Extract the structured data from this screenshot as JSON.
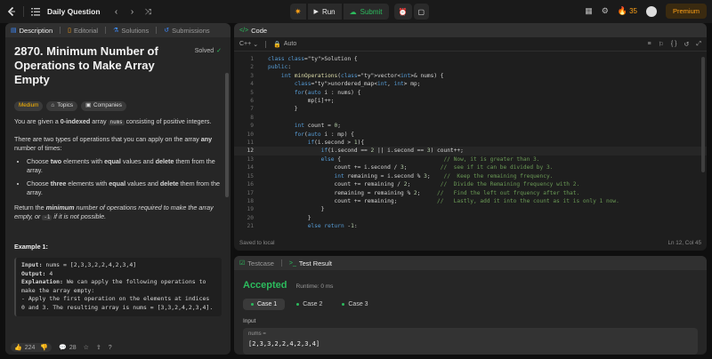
{
  "topbar": {
    "title": "Daily Question",
    "run_label": "Run",
    "submit_label": "Submit",
    "streak_count": "35",
    "premium_label": "Premium"
  },
  "left_tabs": {
    "description": "Description",
    "editorial": "Editorial",
    "solutions": "Solutions",
    "submissions": "Submissions"
  },
  "problem": {
    "title": "2870. Minimum Number of Operations to Make Array Empty",
    "solved_label": "Solved",
    "difficulty": "Medium",
    "topics_label": "Topics",
    "companies_label": "Companies",
    "p1_a": "You are given a ",
    "p1_b": "0-indexed",
    "p1_c": " array ",
    "p1_code": "nums",
    "p1_d": " consisting of positive integers.",
    "p2_a": "There are two types of operations that you can apply on the array ",
    "p2_b": "any",
    "p2_c": " number of times:",
    "b1_a": "Choose ",
    "b1_b": "two",
    "b1_c": " elements with ",
    "b1_d": "equal",
    "b1_e": " values and ",
    "b1_f": "delete",
    "b1_g": " them from the array.",
    "b2_a": "Choose ",
    "b2_b": "three",
    "b2_c": " elements with ",
    "b2_d": "equal",
    "b2_e": " values and ",
    "b2_f": "delete",
    "b2_g": " them from the array.",
    "p3_a": "Return the ",
    "p3_b": "minimum",
    "p3_c": " number of operations required to make the array empty, or ",
    "p3_code": "-1",
    "p3_d": " if it is not possible.",
    "example_title": "Example 1:",
    "ex_input_label": "Input:",
    "ex_input": " nums = [2,3,3,2,2,4,2,3,4]",
    "ex_output_label": "Output:",
    "ex_output": " 4",
    "ex_expl_label": "Explanation:",
    "ex_expl_1": " We can apply the following operations to make the array empty:",
    "ex_expl_2": "- Apply the first operation on the elements at indices 0 and 3. The resulting array is nums = [3,3,2,4,2,3,4]."
  },
  "left_footer": {
    "likes": "224",
    "comments": "28"
  },
  "code_panel": {
    "title": "Code",
    "language": "C++",
    "auto_label": "Auto",
    "status": "Saved to local",
    "cursor": "Ln 12, Col 45",
    "lines": [
      {
        "n": "1",
        "t": "class Solution {"
      },
      {
        "n": "2",
        "t": "public:"
      },
      {
        "n": "3",
        "t": "    int minOperations(vector<int>& nums) {"
      },
      {
        "n": "4",
        "t": "        unordered_map<int, int> mp;"
      },
      {
        "n": "5",
        "t": "        for(auto i : nums) {"
      },
      {
        "n": "6",
        "t": "            mp[i]++;"
      },
      {
        "n": "7",
        "t": "        }"
      },
      {
        "n": "8",
        "t": ""
      },
      {
        "n": "9",
        "t": "        int count = 0;"
      },
      {
        "n": "10",
        "t": "        for(auto i : mp) {"
      },
      {
        "n": "11",
        "t": "            if(i.second > 1){"
      },
      {
        "n": "12",
        "t": "                if(i.second == 2 || i.second == 3) count++;"
      },
      {
        "n": "13",
        "t": "                else {                               // Now, it is greater than 3."
      },
      {
        "n": "14",
        "t": "                    count += i.second / 3;          //  see if it can be divided by 3."
      },
      {
        "n": "15",
        "t": "                    int remaining = i.second % 3;    //  Keep the remaining frequency."
      },
      {
        "n": "16",
        "t": "                    count += remaining / 2;         //  Divide the Remaining frequency with 2."
      },
      {
        "n": "17",
        "t": "                    remaining = remaining % 2;     //   Find the left out frquency after that."
      },
      {
        "n": "18",
        "t": "                    count += remaining;            //   Lastly, add it into the count as it is only 1 now."
      },
      {
        "n": "19",
        "t": "                }"
      },
      {
        "n": "20",
        "t": "            }"
      },
      {
        "n": "21",
        "t": "            else return -1;"
      }
    ]
  },
  "test_panel": {
    "testcase_tab": "Testcase",
    "result_tab": "Test Result",
    "status": "Accepted",
    "runtime": "Runtime: 0 ms",
    "cases": [
      "Case 1",
      "Case 2",
      "Case 3"
    ],
    "input_label": "Input",
    "var_name": "nums =",
    "var_value": "[2,3,3,2,2,4,2,3,4]"
  },
  "colors": {
    "accent_orange": "#ffa116",
    "accepted_green": "#2cbb5d",
    "tab_blue": "#3e8bff"
  }
}
